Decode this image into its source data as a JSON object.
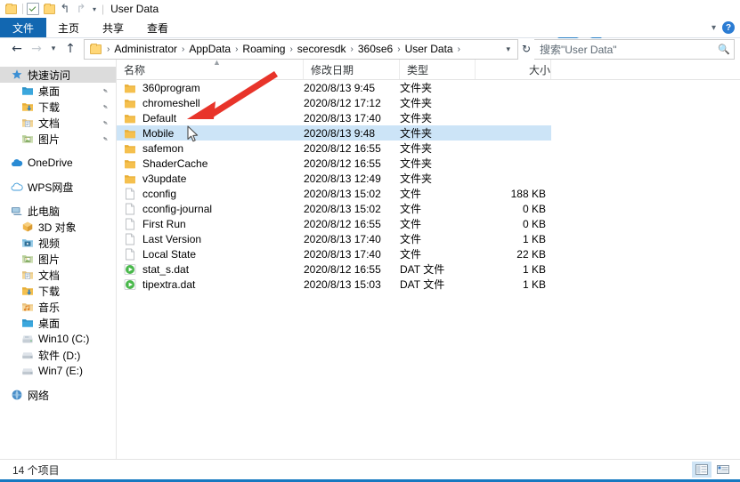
{
  "window": {
    "title": "User Data",
    "quick_access_toolbar": {
      "folder_icon": "folder-icon",
      "properties_icon": "properties-icon",
      "new_folder_icon": "new-folder-icon",
      "undo_icon": "undo-icon",
      "redo_icon": "redo-icon",
      "customize_icon": "chevron-down-icon"
    }
  },
  "ribbon": {
    "tabs": [
      {
        "label": "文件",
        "active": true
      },
      {
        "label": "主页",
        "active": false
      },
      {
        "label": "共享",
        "active": false
      },
      {
        "label": "查看",
        "active": false
      }
    ],
    "collapse_icon": "chevron-down-icon",
    "help_label": "?"
  },
  "address": {
    "back_icon": "arrow-left-icon",
    "forward_icon": "arrow-right-icon",
    "recent_icon": "chevron-down-icon",
    "up_icon": "arrow-up-icon",
    "breadcrumbs": [
      "Administrator",
      "AppData",
      "Roaming",
      "secoresdk",
      "360se6",
      "User Data"
    ],
    "separator": "›",
    "dropdown_icon": "chevron-down-icon",
    "refresh_icon": "refresh-icon"
  },
  "search": {
    "placeholder": "搜索\"User Data\"",
    "icon": "search-icon"
  },
  "sidebar": {
    "items": [
      {
        "label": "快速访问",
        "icon": "star-pin-icon",
        "level": 0,
        "selected": true,
        "pinned": false,
        "gap_before": false
      },
      {
        "label": "桌面",
        "icon": "desktop-folder-icon",
        "level": 1,
        "selected": false,
        "pinned": true,
        "gap_before": false
      },
      {
        "label": "下载",
        "icon": "downloads-folder-icon",
        "level": 1,
        "selected": false,
        "pinned": true,
        "gap_before": false
      },
      {
        "label": "文档",
        "icon": "documents-folder-icon",
        "level": 1,
        "selected": false,
        "pinned": true,
        "gap_before": false
      },
      {
        "label": "图片",
        "icon": "pictures-folder-icon",
        "level": 1,
        "selected": false,
        "pinned": true,
        "gap_before": false
      },
      {
        "label": "OneDrive",
        "icon": "onedrive-cloud-icon",
        "level": 0,
        "selected": false,
        "pinned": false,
        "gap_before": true
      },
      {
        "label": "WPS网盘",
        "icon": "wps-cloud-icon",
        "level": 0,
        "selected": false,
        "pinned": false,
        "gap_before": true
      },
      {
        "label": "此电脑",
        "icon": "this-pc-icon",
        "level": 0,
        "selected": false,
        "pinned": false,
        "gap_before": true
      },
      {
        "label": "3D 对象",
        "icon": "3d-objects-icon",
        "level": 1,
        "selected": false,
        "pinned": false,
        "gap_before": false
      },
      {
        "label": "视频",
        "icon": "videos-folder-icon",
        "level": 1,
        "selected": false,
        "pinned": false,
        "gap_before": false
      },
      {
        "label": "图片",
        "icon": "pictures-folder-icon",
        "level": 1,
        "selected": false,
        "pinned": false,
        "gap_before": false
      },
      {
        "label": "文档",
        "icon": "documents-folder-icon",
        "level": 1,
        "selected": false,
        "pinned": false,
        "gap_before": false
      },
      {
        "label": "下载",
        "icon": "downloads-folder-icon",
        "level": 1,
        "selected": false,
        "pinned": false,
        "gap_before": false
      },
      {
        "label": "音乐",
        "icon": "music-folder-icon",
        "level": 1,
        "selected": false,
        "pinned": false,
        "gap_before": false
      },
      {
        "label": "桌面",
        "icon": "desktop-folder-icon",
        "level": 1,
        "selected": false,
        "pinned": false,
        "gap_before": false
      },
      {
        "label": "Win10 (C:)",
        "icon": "system-drive-icon",
        "level": 1,
        "selected": false,
        "pinned": false,
        "gap_before": false
      },
      {
        "label": "软件 (D:)",
        "icon": "drive-icon",
        "level": 1,
        "selected": false,
        "pinned": false,
        "gap_before": false
      },
      {
        "label": "Win7 (E:)",
        "icon": "drive-icon",
        "level": 1,
        "selected": false,
        "pinned": false,
        "gap_before": false
      },
      {
        "label": "网络",
        "icon": "network-icon",
        "level": 0,
        "selected": false,
        "pinned": false,
        "gap_before": true
      }
    ]
  },
  "filelist": {
    "columns": [
      {
        "label": "名称",
        "key": "name"
      },
      {
        "label": "修改日期",
        "key": "date"
      },
      {
        "label": "类型",
        "key": "type"
      },
      {
        "label": "大小",
        "key": "size"
      }
    ],
    "sort_indicator": "▲",
    "rows": [
      {
        "name": "360program",
        "date": "2020/8/13 9:45",
        "type": "文件夹",
        "size": "",
        "icon": "folder-icon",
        "selected": false
      },
      {
        "name": "chromeshell",
        "date": "2020/8/12 17:12",
        "type": "文件夹",
        "size": "",
        "icon": "folder-icon",
        "selected": false
      },
      {
        "name": "Default",
        "date": "2020/8/13 17:40",
        "type": "文件夹",
        "size": "",
        "icon": "folder-icon",
        "selected": false
      },
      {
        "name": "Mobile",
        "date": "2020/8/13 9:48",
        "type": "文件夹",
        "size": "",
        "icon": "folder-icon",
        "selected": true
      },
      {
        "name": "safemon",
        "date": "2020/8/12 16:55",
        "type": "文件夹",
        "size": "",
        "icon": "folder-icon",
        "selected": false
      },
      {
        "name": "ShaderCache",
        "date": "2020/8/12 16:55",
        "type": "文件夹",
        "size": "",
        "icon": "folder-icon",
        "selected": false
      },
      {
        "name": "v3update",
        "date": "2020/8/13 12:49",
        "type": "文件夹",
        "size": "",
        "icon": "folder-icon",
        "selected": false
      },
      {
        "name": "cconfig",
        "date": "2020/8/13 15:02",
        "type": "文件",
        "size": "188 KB",
        "icon": "file-icon",
        "selected": false
      },
      {
        "name": "cconfig-journal",
        "date": "2020/8/13 15:02",
        "type": "文件",
        "size": "0 KB",
        "icon": "file-icon",
        "selected": false
      },
      {
        "name": "First Run",
        "date": "2020/8/12 16:55",
        "type": "文件",
        "size": "0 KB",
        "icon": "file-icon",
        "selected": false
      },
      {
        "name": "Last Version",
        "date": "2020/8/13 17:40",
        "type": "文件",
        "size": "1 KB",
        "icon": "file-icon",
        "selected": false
      },
      {
        "name": "Local State",
        "date": "2020/8/13 17:40",
        "type": "文件",
        "size": "22 KB",
        "icon": "file-icon",
        "selected": false
      },
      {
        "name": "stat_s.dat",
        "date": "2020/8/12 16:55",
        "type": "DAT 文件",
        "size": "1 KB",
        "icon": "dat-file-icon",
        "selected": false
      },
      {
        "name": "tipextra.dat",
        "date": "2020/8/13 15:03",
        "type": "DAT 文件",
        "size": "1 KB",
        "icon": "dat-file-icon",
        "selected": false
      }
    ]
  },
  "statusbar": {
    "item_count": "14 个项目",
    "view_details_icon": "details-view-icon",
    "view_tiles_icon": "tiles-view-icon"
  },
  "annotation": {
    "arrow_icon": "red-arrow-annotation",
    "arrow_color": "#e8342a",
    "cursor_icon": "mouse-cursor"
  },
  "watermark": {
    "icon": "blue-globe-logo",
    "color": "#1f7ac4"
  }
}
